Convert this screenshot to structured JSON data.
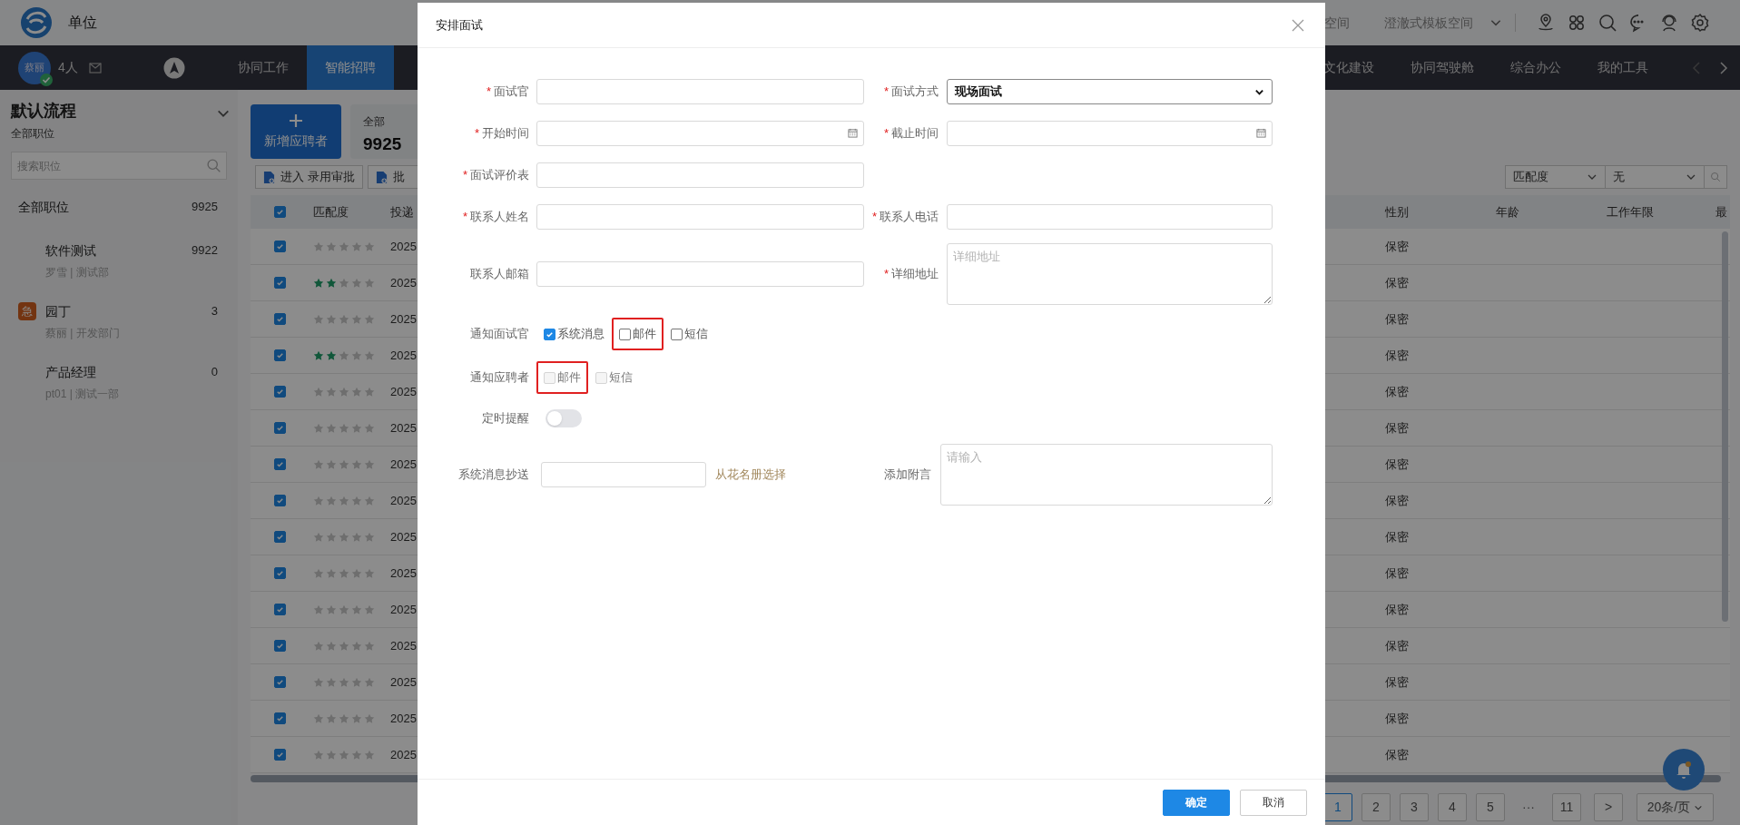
{
  "header": {
    "unit": "单位",
    "spaces": [
      "空间",
      "澄澈式模板空间"
    ]
  },
  "nav": {
    "avatar_text": "蔡丽",
    "count": "4人",
    "tabs_left": [
      {
        "label": "协同工作",
        "selected": false
      },
      {
        "label": "智能招聘",
        "selected": true
      }
    ],
    "tabs_right": [
      {
        "label": "文化建设",
        "selected": false
      },
      {
        "label": "协同驾驶舱",
        "selected": false
      },
      {
        "label": "综合办公",
        "selected": false
      },
      {
        "label": "我的工具",
        "selected": false
      }
    ]
  },
  "sidebar": {
    "title": "默认流程",
    "subtitle": "全部职位",
    "search_placeholder": "搜索职位",
    "items": [
      {
        "name": "全部职位",
        "count": "9925",
        "children": [
          {
            "name": "软件测试",
            "count": "9922",
            "meta": "罗雪 | 测试部"
          },
          {
            "name": "园丁",
            "count": "3",
            "meta": "蔡丽 | 开发部门",
            "badge": "急"
          },
          {
            "name": "产品经理",
            "count": "0",
            "meta": "pt01 | 测试一部"
          }
        ]
      }
    ]
  },
  "main": {
    "add_button": "新增应聘者",
    "summary": {
      "label": "全部",
      "value": "9925"
    },
    "actions": [
      "进入 录用审批",
      "批"
    ],
    "sort": {
      "field": "匹配度",
      "order": "无"
    },
    "table": {
      "all_checked": true,
      "columns": [
        "匹配度",
        "投递",
        "性别",
        "年龄",
        "工作年限",
        "最"
      ],
      "rows": [
        {
          "checked": true,
          "stars": 0,
          "date": "2025",
          "gender": "保密"
        },
        {
          "checked": true,
          "stars": 2,
          "date": "2025",
          "gender": "保密"
        },
        {
          "checked": true,
          "stars": 0,
          "date": "2025",
          "gender": "保密"
        },
        {
          "checked": true,
          "stars": 2,
          "date": "2025",
          "gender": "保密"
        },
        {
          "checked": true,
          "stars": 0,
          "date": "2025",
          "gender": "保密"
        },
        {
          "checked": true,
          "stars": 0,
          "date": "2025",
          "gender": "保密"
        },
        {
          "checked": true,
          "stars": 0,
          "date": "2025",
          "gender": "保密"
        },
        {
          "checked": true,
          "stars": 0,
          "date": "2025",
          "gender": "保密"
        },
        {
          "checked": true,
          "stars": 0,
          "date": "2025",
          "gender": "保密"
        },
        {
          "checked": true,
          "stars": 0,
          "date": "2025",
          "gender": "保密"
        },
        {
          "checked": true,
          "stars": 0,
          "date": "2025",
          "gender": "保密"
        },
        {
          "checked": true,
          "stars": 0,
          "date": "2025",
          "gender": "保密"
        },
        {
          "checked": true,
          "stars": 0,
          "date": "2025",
          "gender": "保密"
        },
        {
          "checked": true,
          "stars": 0,
          "date": "2025",
          "gender": "保密"
        },
        {
          "checked": true,
          "stars": 0,
          "date": "2025",
          "gender": "保密"
        }
      ]
    },
    "pagination": {
      "pages": [
        {
          "kind": "page",
          "label": "1",
          "selected": true
        },
        {
          "kind": "page",
          "label": "2",
          "selected": false
        },
        {
          "kind": "page",
          "label": "3",
          "selected": false
        },
        {
          "kind": "page",
          "label": "4",
          "selected": false
        },
        {
          "kind": "page",
          "label": "5",
          "selected": false
        },
        {
          "kind": "ellipsis",
          "label": "···"
        },
        {
          "kind": "page",
          "label": "11",
          "selected": false
        }
      ],
      "next": ">",
      "page_size": "20条/页"
    }
  },
  "dialog": {
    "title": "安排面试",
    "rows": [
      [
        {
          "kind": "input",
          "mark": "*",
          "label": "面试官"
        },
        {
          "kind": "select",
          "mark": "*",
          "label": "面试方式",
          "value": "现场面试"
        }
      ],
      [
        {
          "kind": "date",
          "mark": "*",
          "label": "开始时间"
        },
        {
          "kind": "date",
          "mark": "*",
          "label": "截止时间"
        }
      ],
      [
        {
          "kind": "input",
          "mark": "*",
          "label": "面试评价表"
        }
      ],
      [
        {
          "kind": "input",
          "mark": "*",
          "label": "联系人姓名"
        },
        {
          "kind": "input",
          "mark": "*",
          "label": "联系人电话"
        }
      ],
      [
        {
          "kind": "input",
          "label": "联系人邮箱"
        },
        {
          "kind": "textarea",
          "mark": "*",
          "label": "详细地址",
          "placeholder": "详细地址"
        }
      ]
    ],
    "notify": [
      {
        "label": "通知面试官",
        "options": [
          {
            "label": "系统消息",
            "checked": true,
            "disabled": false,
            "highlighted": false
          },
          {
            "label": "邮件",
            "checked": false,
            "disabled": false,
            "highlighted": true
          },
          {
            "label": "短信",
            "checked": false,
            "disabled": false,
            "highlighted": false
          }
        ]
      },
      {
        "label": "通知应聘者",
        "options": [
          {
            "label": "邮件",
            "checked": false,
            "disabled": true,
            "highlighted": true
          },
          {
            "label": "短信",
            "checked": false,
            "disabled": true,
            "highlighted": false
          }
        ]
      }
    ],
    "reminder": {
      "label": "定时提醒",
      "on": false
    },
    "cc": {
      "label": "系统消息抄送",
      "link": "从花名册选择"
    },
    "note": {
      "label": "添加附言",
      "placeholder": "请输入"
    },
    "buttons": [
      {
        "kind": "primary",
        "label": "确定"
      },
      {
        "kind": "default",
        "label": "取消"
      }
    ]
  }
}
